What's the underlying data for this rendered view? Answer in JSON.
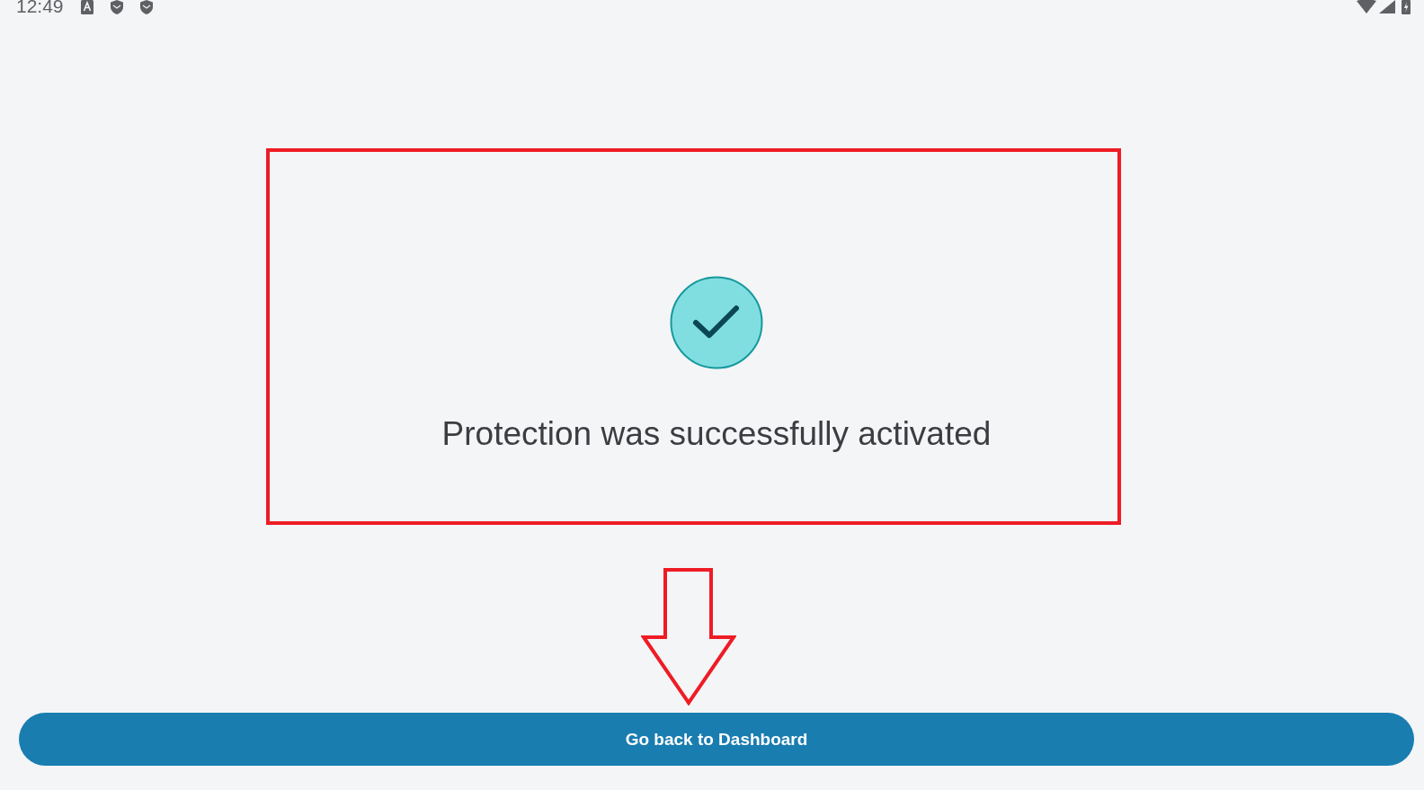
{
  "status_bar": {
    "time": "12:49"
  },
  "message": {
    "text": "Protection was successfully activated"
  },
  "button": {
    "label": "Go back to Dashboard"
  }
}
